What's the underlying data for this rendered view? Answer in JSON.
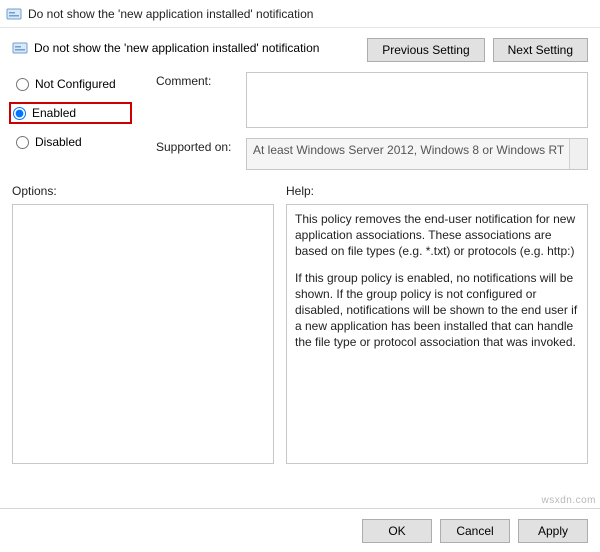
{
  "window": {
    "title": "Do not show the 'new application installed' notification"
  },
  "header": {
    "policy_title": "Do not show the 'new application installed' notification",
    "previous_setting": "Previous Setting",
    "next_setting": "Next Setting"
  },
  "state": {
    "not_configured": "Not Configured",
    "enabled": "Enabled",
    "disabled": "Disabled",
    "selected": "enabled"
  },
  "fields": {
    "comment_label": "Comment:",
    "comment_value": "",
    "supported_label": "Supported on:",
    "supported_value": "At least Windows Server 2012, Windows 8 or Windows RT"
  },
  "sections": {
    "options_label": "Options:",
    "help_label": "Help:",
    "help_text_p1": "This policy removes the end-user notification for new application associations. These associations are based on file types (e.g. *.txt) or protocols (e.g. http:)",
    "help_text_p2": "If this group policy is enabled, no notifications will be shown. If the group policy is not configured or disabled, notifications will be shown to the end user if a new application has been installed that can handle the file type or protocol association that was invoked."
  },
  "buttons": {
    "ok": "OK",
    "cancel": "Cancel",
    "apply": "Apply"
  },
  "watermark": "wsxdn.com"
}
